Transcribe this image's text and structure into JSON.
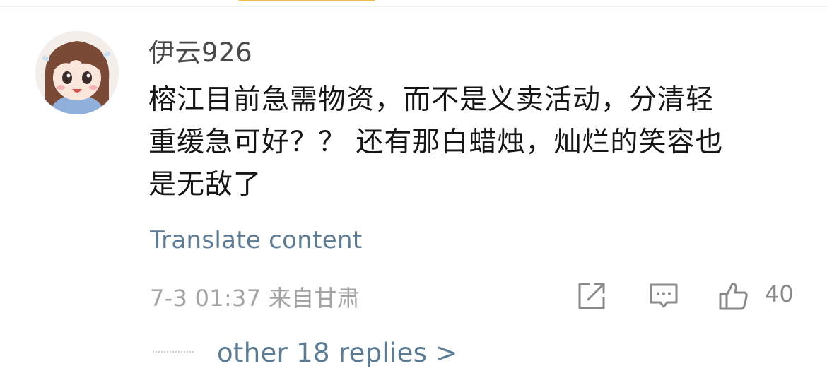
{
  "comment": {
    "username": "伊云926",
    "text_lines": [
      "榕江目前急需物资，而不是义卖活动，分清轻",
      "重缓急可好？？ 还有那白蜡烛，灿烂的笑容也",
      "是无敌了"
    ],
    "translate_label": "Translate content",
    "timestamp": "7-3 01:37",
    "location": "来自甘肃",
    "like_count": "40",
    "replies_label": "other 18 replies >"
  },
  "icons": {
    "avatar": "avatar-cartoon-girl",
    "share": "share-icon",
    "comment": "comment-icon",
    "like": "thumbs-up-icon"
  }
}
